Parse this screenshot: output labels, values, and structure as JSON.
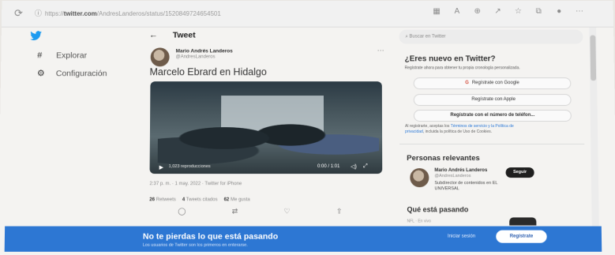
{
  "browser": {
    "reload_icon": "reload-icon",
    "url_prefix": "https://",
    "url_host": "twitter.com",
    "url_path": "/AndresLanderos/status/1520849724654501"
  },
  "sidebar": {
    "logo": "twitter-bird-icon",
    "items": [
      {
        "icon": "#",
        "label": "Explorar"
      },
      {
        "icon": "⚙",
        "label": "Configuración"
      }
    ]
  },
  "header": {
    "back": "←",
    "title": "Tweet"
  },
  "tweet": {
    "author_name": "Mario Andrés Landeros",
    "author_handle": "@AndresLanderos",
    "text": "Marcelo Ebrard en Hidalgo",
    "video_caption": "1,023 reproducciones",
    "video_time": "0:00 / 1:01",
    "meta": "2:37 p. m. · 1 may. 2022 · Twitter for iPhone",
    "retweets_count": "26",
    "retweets_label": "Retweets",
    "quotes_count": "4",
    "quotes_label": "Tweets citados",
    "likes_count": "62",
    "likes_label": "Me gusta"
  },
  "right": {
    "search_placeholder": "Buscar en Twitter",
    "new_title": "¿Eres nuevo en Twitter?",
    "new_sub": "Regístrate ahora para obtener tu propia cronología personalizada.",
    "google_btn": "Regístrate con Google",
    "apple_btn": "Regístrate con Apple",
    "phone_btn": "Regístrate con el número de teléfon...",
    "terms_prefix": "Al registrarte, aceptas los ",
    "terms_link": "Términos de servicio y la Política de privacidad",
    "terms_suffix": ", incluida la política de Uso de Cookies.",
    "relevant_title": "Personas relevantes",
    "person_name": "Mario Andrés Landeros",
    "person_handle": "@AndresLanderos",
    "person_bio": "Subdirector de contenidos en EL UNIVERSAL",
    "follow_btn": "Seguir",
    "trending_title": "Qué está pasando",
    "trending_peek": "NFL · En vivo"
  },
  "banner": {
    "title": "No te pierdas lo que está pasando",
    "sub": "Los usuarios de Twitter son los primeros en enterarse.",
    "login": "Iniciar sesión",
    "signup": "Regístrate"
  }
}
